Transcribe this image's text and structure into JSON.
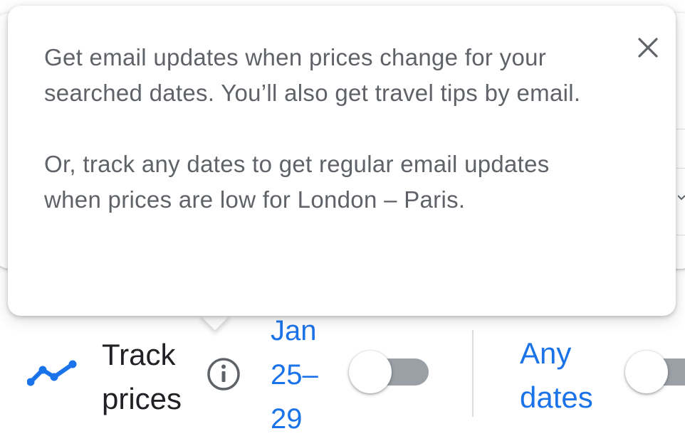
{
  "tooltip": {
    "paragraph1": "Get email updates when prices change for your searched dates. You’ll also get travel tips by email.",
    "paragraph2": "Or, track any dates to get regular email updates when prices are low for London – Paris.",
    "close_icon": "close-icon"
  },
  "track_prices": {
    "icon": "trending-up-icon",
    "label": "Track prices",
    "info_icon": "info-icon",
    "dates_label": "Jan 25–29",
    "dates_toggle_on": false,
    "any_dates_label": "Any dates",
    "any_dates_toggle_on": false
  },
  "colors": {
    "accent": "#1a73e8",
    "text_primary": "#202124",
    "text_secondary": "#5f6368",
    "toggle_track_off": "#9aa0a6"
  }
}
